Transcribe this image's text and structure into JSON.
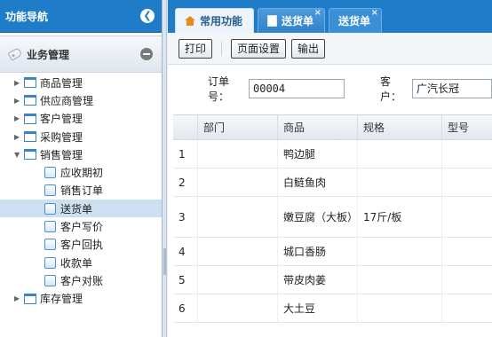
{
  "sidebar": {
    "title": "功能导航",
    "collapse_glyph": "❮",
    "group": {
      "label": "业务管理"
    },
    "items": [
      {
        "label": "商品管理",
        "type": "folder",
        "expanded": false
      },
      {
        "label": "供应商管理",
        "type": "folder",
        "expanded": false
      },
      {
        "label": "客户管理",
        "type": "folder",
        "expanded": false
      },
      {
        "label": "采购管理",
        "type": "folder",
        "expanded": false
      },
      {
        "label": "销售管理",
        "type": "folder",
        "expanded": true
      },
      {
        "label": "应收期初",
        "type": "page"
      },
      {
        "label": "销售订单",
        "type": "page"
      },
      {
        "label": "送货单",
        "type": "page",
        "selected": true
      },
      {
        "label": "客户写价",
        "type": "page"
      },
      {
        "label": "客户回执",
        "type": "page"
      },
      {
        "label": "收款单",
        "type": "page"
      },
      {
        "label": "客户对账",
        "type": "page"
      },
      {
        "label": "库存管理",
        "type": "folder",
        "expanded": false
      }
    ]
  },
  "tabs": [
    {
      "label": "常用功能",
      "icon": "home-icon"
    },
    {
      "label": "送货单",
      "icon": "page-icon",
      "close": "×"
    },
    {
      "label": "送货单",
      "close": "×",
      "active": true
    }
  ],
  "toolbar": {
    "print_label": "打印",
    "page_setup_label": "页面设置",
    "export_label": "输出"
  },
  "form": {
    "order_no_label": "订单号：",
    "order_no_value": "00004",
    "customer_label": "客户：",
    "customer_value": "广汽长冠"
  },
  "grid": {
    "columns": [
      "",
      "部门",
      "商品",
      "规格",
      "型号"
    ],
    "rows": [
      {
        "no": "1",
        "dept": "",
        "product": "鸭边腿",
        "spec": "",
        "model": ""
      },
      {
        "no": "2",
        "dept": "",
        "product": "白鲢鱼肉",
        "spec": "",
        "model": ""
      },
      {
        "no": "3",
        "dept": "",
        "product": "嫩豆腐（大板）",
        "spec": "17斤/板",
        "model": ""
      },
      {
        "no": "4",
        "dept": "",
        "product": "城口香肠",
        "spec": "",
        "model": ""
      },
      {
        "no": "5",
        "dept": "",
        "product": "带皮肉姜",
        "spec": "",
        "model": ""
      },
      {
        "no": "6",
        "dept": "",
        "product": "大土豆",
        "spec": "",
        "model": ""
      }
    ]
  },
  "colors": {
    "header_blue": "#1f7cc8",
    "selected_row": "#cde0f2",
    "home_icon": "#e98a1f"
  }
}
